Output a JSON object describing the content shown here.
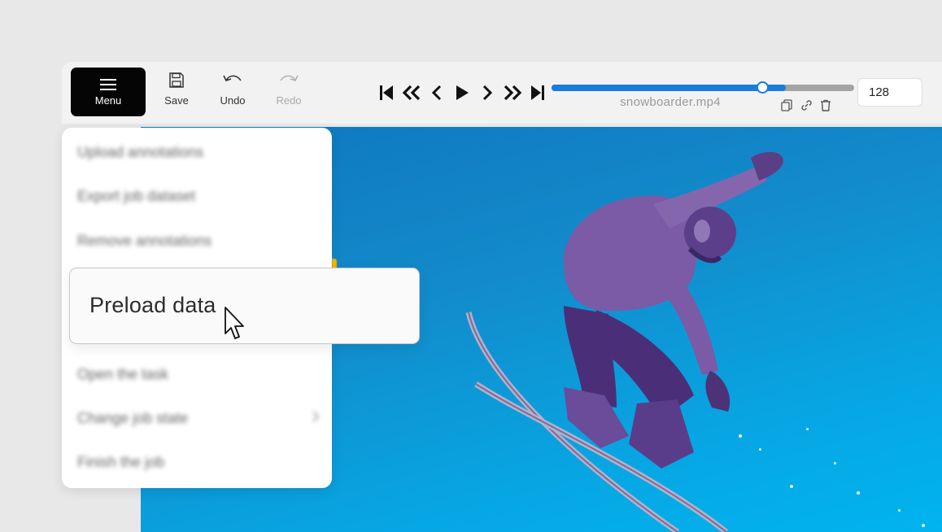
{
  "toolbar": {
    "menu_label": "Menu",
    "save_label": "Save",
    "undo_label": "Undo",
    "redo_label": "Redo"
  },
  "player": {
    "filename": "snowboarder.mp4",
    "frame_number": "128",
    "progress_fraction": 0.695,
    "buffered_fraction": 0.775
  },
  "menu": {
    "items": [
      {
        "label": "Upload annotations"
      },
      {
        "label": "Export job dataset"
      },
      {
        "label": "Remove annotations"
      },
      {
        "label": "Preload data"
      },
      {
        "label": "Open the task"
      },
      {
        "label": "Change job state"
      },
      {
        "label": "Finish the job"
      }
    ]
  },
  "colors": {
    "accent": "#1a7cdb",
    "menu_button_bg": "#050505",
    "sky": "#07a6e3",
    "jacket": "#7b5aa6",
    "indicator": "#f2b400"
  }
}
